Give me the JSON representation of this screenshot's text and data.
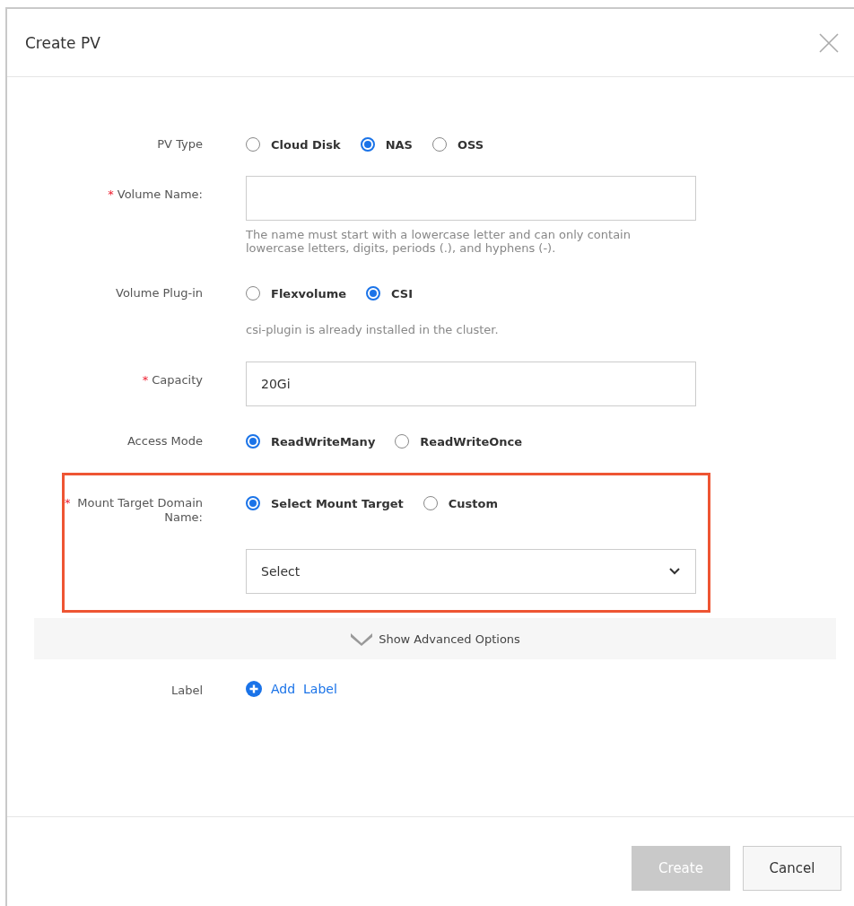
{
  "dialog": {
    "title": "Create PV"
  },
  "fields": [
    {
      "kind": "radio",
      "label": "PV Type",
      "options": [
        {
          "label": "Cloud Disk",
          "selected": false
        },
        {
          "label": "NAS",
          "selected": true
        },
        {
          "label": "OSS",
          "selected": false
        }
      ]
    },
    {
      "kind": "text",
      "label": "Volume Name:",
      "required_mark": "*",
      "hint": "The name must start with a lowercase letter and can only contain lowercase letters, digits, periods (.), and hyphens (-)."
    },
    {
      "kind": "radio",
      "label": "Volume Plug-in",
      "options": [
        {
          "label": "Flexvolume",
          "selected": false
        },
        {
          "label": "CSI",
          "selected": true
        }
      ],
      "note": "csi-plugin is already installed in the cluster."
    },
    {
      "kind": "text",
      "label": "Capacity",
      "required_mark": "*",
      "value": "20Gi"
    },
    {
      "kind": "radio",
      "label": "Access Mode",
      "options": [
        {
          "label": "ReadWriteMany",
          "selected": true
        },
        {
          "label": "ReadWriteOnce",
          "selected": false
        }
      ]
    },
    {
      "kind": "radio-select",
      "label": "Mount Target Domain Name:",
      "required_mark": "*",
      "highlighted": true,
      "options": [
        {
          "label": "Select Mount Target",
          "selected": true
        },
        {
          "label": "Custom",
          "selected": false
        }
      ],
      "select": "Select"
    }
  ],
  "advanced_toggle": "Show Advanced Options",
  "label_row": {
    "label": "Label",
    "link": "Add  Label"
  },
  "buttons": [
    {
      "label": "Create",
      "kind": "primary",
      "disabled": true
    },
    {
      "label": "Cancel",
      "kind": "default",
      "disabled": false
    }
  ]
}
